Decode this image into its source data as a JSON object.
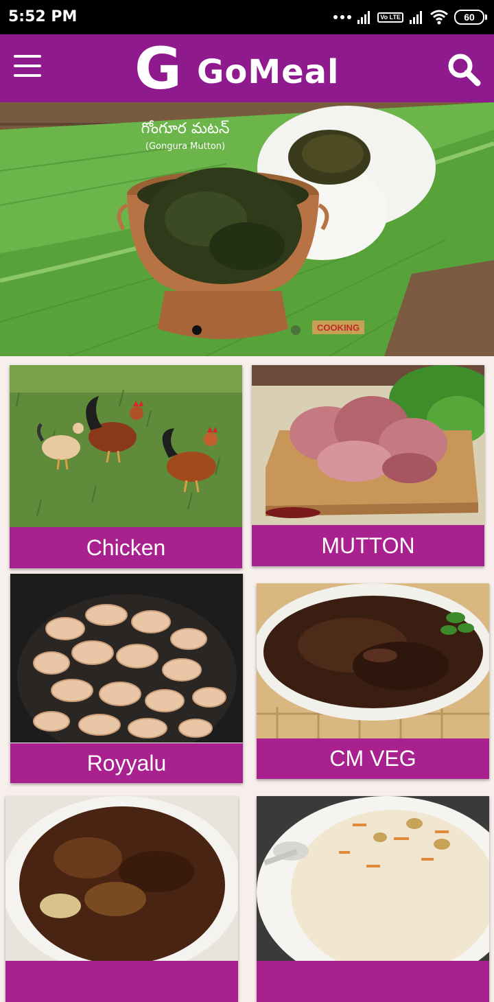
{
  "status_bar": {
    "time": "5:52 PM",
    "volte_label": "Vo LTE",
    "battery": "60"
  },
  "app_bar": {
    "logo_letter": "G",
    "app_name": "GoMeal"
  },
  "banner": {
    "title_telugu": "గోంగూర మటన్",
    "title_english": "(Gongura Mutton)",
    "watermark": "COOKING",
    "current_slide": 1
  },
  "categories": [
    {
      "label": "Chicken"
    },
    {
      "label": "MUTTON"
    },
    {
      "label": "Royyalu"
    },
    {
      "label": "CM VEG"
    },
    {
      "label": ""
    },
    {
      "label": ""
    }
  ],
  "colors": {
    "app_bar": "#8e1a8e",
    "card_label": "#a8218f",
    "page_bg": "#f7efec"
  }
}
